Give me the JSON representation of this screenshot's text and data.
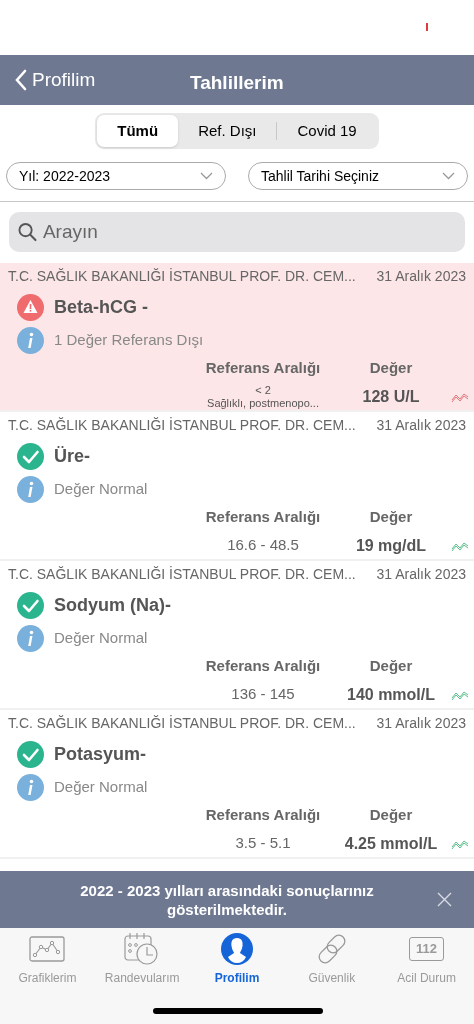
{
  "nav": {
    "back_label": "Profilim",
    "title": "Tahlillerim"
  },
  "segments": [
    {
      "label": "Tümü",
      "selected": true
    },
    {
      "label": "Ref. Dışı",
      "selected": false
    },
    {
      "label": "Covid 19",
      "selected": false
    }
  ],
  "filters": [
    {
      "value": "Yıl: 2022-2023"
    },
    {
      "value": "Tahlil Tarihi Seçiniz"
    }
  ],
  "search": {
    "placeholder": "Arayın"
  },
  "results": [
    {
      "institution": "T.C. SAĞLIK BAKANLIĞI İSTANBUL PROF. DR. CEM...",
      "date": "31 Aralık 2023",
      "test": "Beta-hCG -",
      "kind": "alert",
      "note": "1 Değer Referans Dışı",
      "ref_header": "Referans Aralığı",
      "value_header": "Değer",
      "reference": "< 2",
      "reference_note": "Sağlıklı, postmenopo...",
      "value": "128 U/L"
    },
    {
      "institution": "T.C. SAĞLIK BAKANLIĞI İSTANBUL PROF. DR. CEM...",
      "date": "31 Aralık 2023",
      "test": "Üre-",
      "kind": "normal",
      "note": "Değer Normal",
      "ref_header": "Referans Aralığı",
      "value_header": "Değer",
      "reference": "16.6 - 48.5",
      "value": "19 mg/dL"
    },
    {
      "institution": "T.C. SAĞLIK BAKANLIĞI İSTANBUL PROF. DR. CEM...",
      "date": "31 Aralık 2023",
      "test": "Sodyum (Na)-",
      "kind": "normal",
      "note": "Değer Normal",
      "ref_header": "Referans Aralığı",
      "value_header": "Değer",
      "reference": "136 - 145",
      "value": "140 mmol/L"
    },
    {
      "institution": "T.C. SAĞLIK BAKANLIĞI İSTANBUL PROF. DR. CEM...",
      "date": "31 Aralık 2023",
      "test": "Potasyum-",
      "kind": "normal",
      "note": "Değer Normal",
      "ref_header": "Referans Aralığı",
      "value_header": "Değer",
      "reference": "3.5 - 5.1",
      "value": "4.25 mmol/L"
    }
  ],
  "banner": {
    "message": "2022 - 2023 yılları arasındaki sonuçlarınız gösterilmektedir."
  },
  "tabbar": [
    {
      "kind": "chart",
      "label": "Grafiklerim",
      "selected": false
    },
    {
      "kind": "calendar",
      "label": "Randevularım",
      "selected": false
    },
    {
      "kind": "profile",
      "label": "Profilim",
      "selected": true
    },
    {
      "kind": "link",
      "label": "Güvenlik",
      "selected": false
    },
    {
      "kind": "emergency",
      "label": "Acil Durum",
      "selected": false,
      "badge": "112"
    }
  ]
}
